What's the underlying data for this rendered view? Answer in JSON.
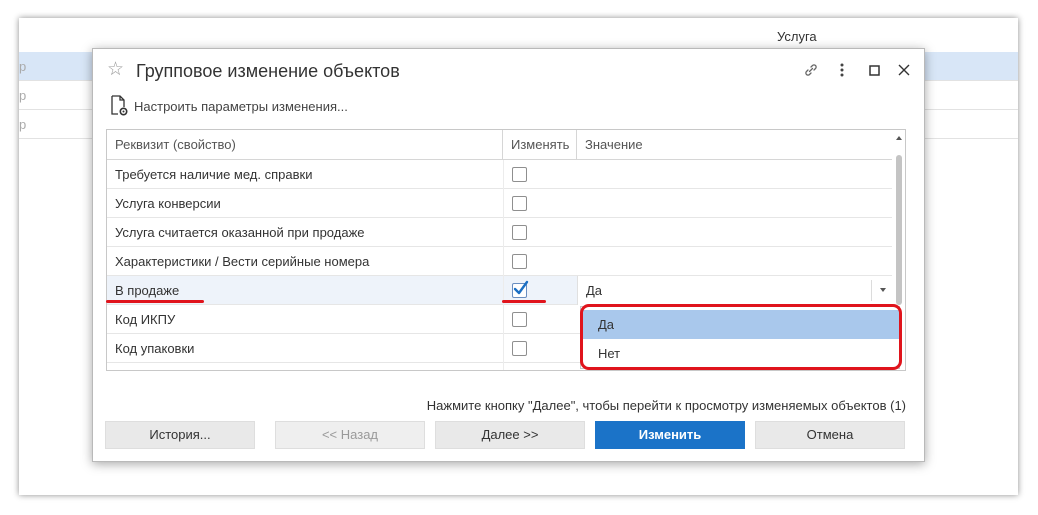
{
  "background": {
    "column_header": "Услуга",
    "rows": [
      {
        "text": "р"
      },
      {
        "text": "р"
      },
      {
        "text": "р"
      }
    ]
  },
  "dialog": {
    "title": "Групповое изменение объектов",
    "settings_link": "Настроить параметры изменения...",
    "columns": {
      "attribute": "Реквизит (свойство)",
      "change": "Изменять",
      "value": "Значение"
    },
    "rows": [
      {
        "label": "Требуется наличие мед. справки",
        "checked": false,
        "value": ""
      },
      {
        "label": "Услуга конверсии",
        "checked": false,
        "value": ""
      },
      {
        "label": "Услуга считается оказанной при продаже",
        "checked": false,
        "value": ""
      },
      {
        "label": "Характеристики / Вести серийные номера",
        "checked": false,
        "value": ""
      },
      {
        "label": "В продаже",
        "checked": true,
        "value": "Да"
      },
      {
        "label": "Код ИКПУ",
        "checked": false,
        "value": ""
      },
      {
        "label": "Код упаковки",
        "checked": false,
        "value": ""
      }
    ],
    "dropdown_options": [
      "Да",
      "Нет"
    ],
    "dropdown_selected": "Да",
    "hint": "Нажмите кнопку \"Далее\", чтобы перейти к просмотру изменяемых объектов (1)",
    "buttons": {
      "history": "История...",
      "back": "<<   Назад",
      "next": "Далее   >>",
      "apply": "Изменить",
      "cancel": "Отмена"
    }
  },
  "colors": {
    "accent": "#1b73c8",
    "highlight_frame": "#e0141c",
    "selected_option": "#a9c8ec"
  }
}
